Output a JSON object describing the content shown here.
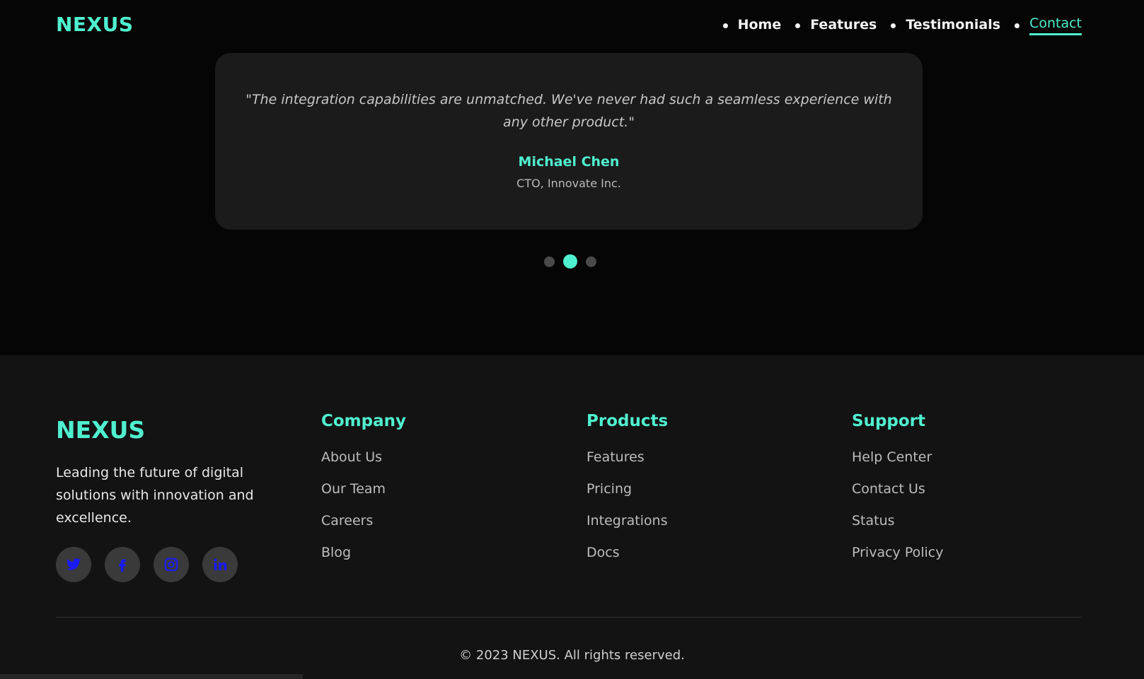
{
  "header": {
    "logo": "NEXUS",
    "nav": [
      {
        "label": "Home"
      },
      {
        "label": "Features"
      },
      {
        "label": "Testimonials"
      },
      {
        "label": "Contact"
      }
    ]
  },
  "testimonial": {
    "quote": "\"The integration capabilities are unmatched. We've never had such a seamless experience with any other product.\"",
    "author": "Michael Chen",
    "role": "CTO, Innovate Inc.",
    "active_index": 1,
    "count": 3
  },
  "footer": {
    "logo": "NEXUS",
    "description": "Leading the future of digital solutions with innovation and excellence.",
    "socials": [
      "twitter-icon",
      "facebook-icon",
      "instagram-icon",
      "linkedin-icon"
    ],
    "columns": [
      {
        "title": "Company",
        "links": [
          "About Us",
          "Our Team",
          "Careers",
          "Blog"
        ]
      },
      {
        "title": "Products",
        "links": [
          "Features",
          "Pricing",
          "Integrations",
          "Docs"
        ]
      },
      {
        "title": "Support",
        "links": [
          "Help Center",
          "Contact Us",
          "Status",
          "Privacy Policy"
        ]
      }
    ],
    "copyright": "© 2023 NEXUS. All rights reserved."
  },
  "colors": {
    "accent": "#4ff0cf",
    "background": "#050505",
    "card": "#1b1b1b",
    "footer": "#131313",
    "social_icon": "#1a1aff"
  }
}
